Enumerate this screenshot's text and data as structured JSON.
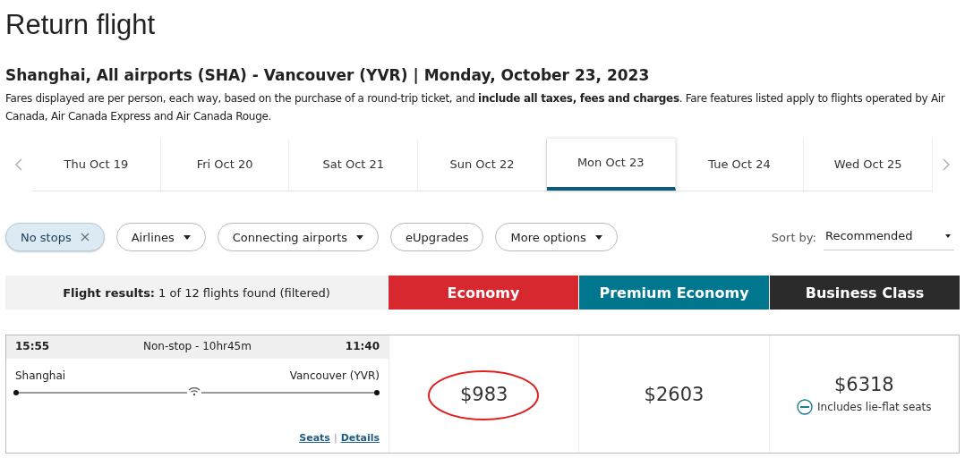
{
  "title": "Return flight",
  "route": {
    "origin": "Shanghai, All airports (SHA) - Vancouver (YVR)",
    "separator": "|",
    "date": "Monday, October 23, 2023"
  },
  "notice": "Fares displayed are per person, each way, based on the purchase of a round-trip ticket, and **include all taxes, fees and charges**. Fare features listed apply to flights operated by Air Canada, Air Canada Express and Air Canada Rouge.",
  "date_tabs": [
    {
      "label": "Thu Oct 19",
      "selected": false
    },
    {
      "label": "Fri Oct 20",
      "selected": false
    },
    {
      "label": "Sat Oct 21",
      "selected": false
    },
    {
      "label": "Sun Oct 22",
      "selected": false
    },
    {
      "label": "Mon Oct 23",
      "selected": true
    },
    {
      "label": "Tue Oct 24",
      "selected": false
    },
    {
      "label": "Wed Oct 25",
      "selected": false
    }
  ],
  "filters": [
    {
      "label": "No stops",
      "selected": true,
      "kind": "removable"
    },
    {
      "label": "Airlines",
      "selected": false,
      "kind": "dropdown"
    },
    {
      "label": "Connecting airports",
      "selected": false,
      "kind": "dropdown"
    },
    {
      "label": "eUpgrades",
      "selected": false,
      "kind": "plain"
    },
    {
      "label": "More options",
      "selected": false,
      "kind": "dropdown"
    }
  ],
  "sort": {
    "label": "Sort by:",
    "value": "Recommended"
  },
  "results": {
    "label": "Flight results:",
    "count": "1 of 12 flights found (filtered)"
  },
  "cabins": [
    {
      "name": "Economy",
      "color": "#d7282f"
    },
    {
      "name": "Premium Economy",
      "color": "#00778f"
    },
    {
      "name": "Business Class",
      "color": "#2b2b2b"
    }
  ],
  "flight": {
    "depart": "15:55",
    "duration": "Non-stop - 10hr45m",
    "arrive": "11:40",
    "from": "Shanghai",
    "to": "Vancouver (YVR)",
    "wifi": true,
    "links": [
      "Seats",
      "Details"
    ],
    "link_separator": "|",
    "fares": [
      {
        "price": "$983",
        "highlighted": true
      },
      {
        "price": "$2603",
        "highlighted": false
      },
      {
        "price": "$6318",
        "highlighted": false,
        "feature": "Includes lie-flat seats"
      }
    ]
  }
}
